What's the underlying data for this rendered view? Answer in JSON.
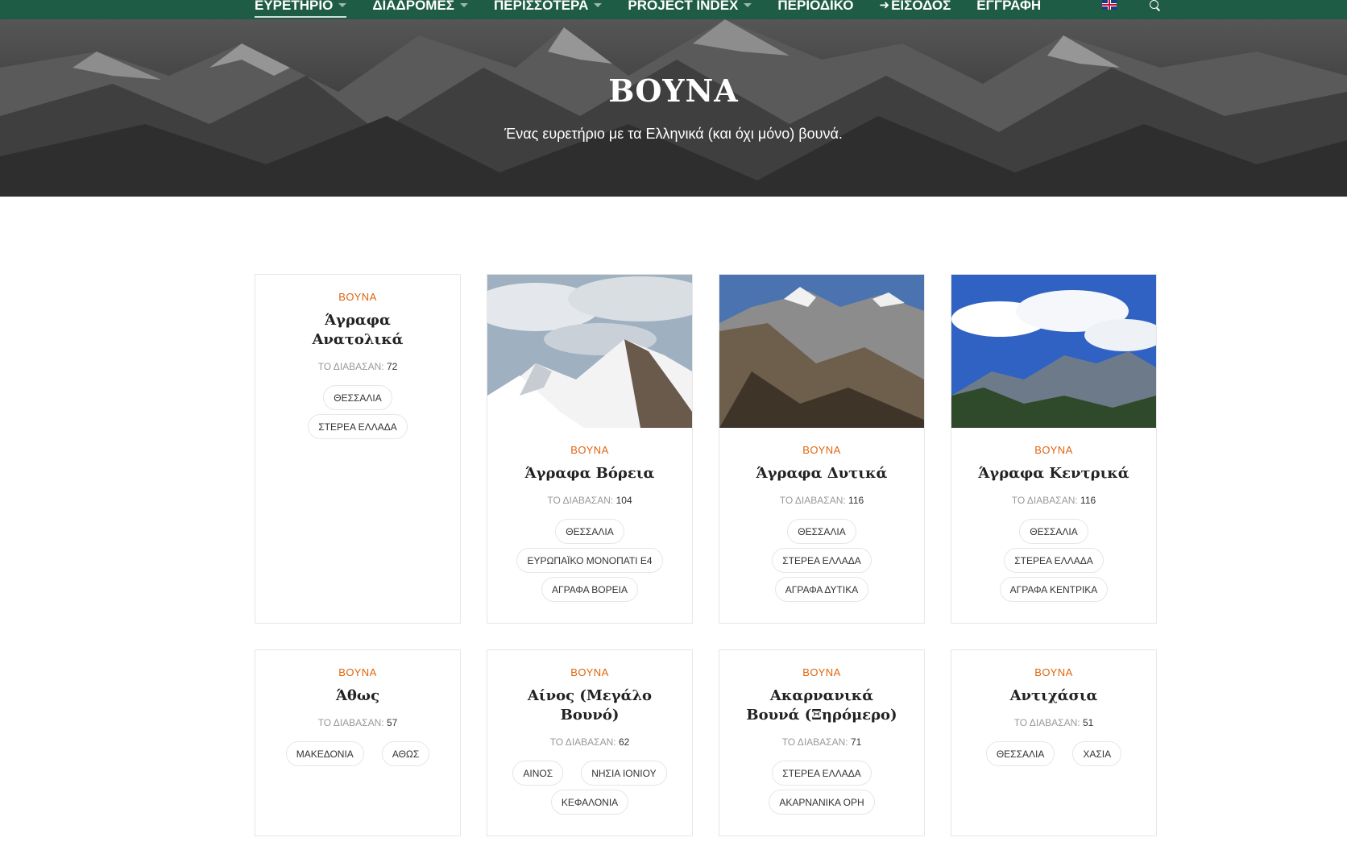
{
  "nav": {
    "items": [
      {
        "label": "ΕΥΡΕΤΗΡΙΟ",
        "caret": true,
        "active": true
      },
      {
        "label": "ΔΙΑΔΡΟΜΕΣ",
        "caret": true
      },
      {
        "label": "ΠΕΡΙΣΣΟΤΕΡΑ",
        "caret": true
      },
      {
        "label": "PROJECT INDEX",
        "caret": true
      },
      {
        "label": "ΠΕΡΙΟΔΙΚΟ",
        "caret": false
      },
      {
        "label": "ΕΙΣΟΔΟΣ",
        "caret": false,
        "icon": "login-icon"
      },
      {
        "label": "ΕΓΓΡΑΦΗ",
        "caret": false
      }
    ],
    "language_icon": "uk-flag-icon",
    "search_icon": "search-icon"
  },
  "hero": {
    "title": "ΒΟΥΝΑ",
    "subtitle": "Ένας ευρετήριο με τα Ελληνικά (και όχι μόνο) βουνά."
  },
  "cards": [
    {
      "category": "ΒΟΥΝΑ",
      "title": "Άγραφα Ανατολικά",
      "reads_label": "ΤΟ ΔΙΑΒΑΣΑΝ:",
      "reads": "72",
      "tags": [
        [
          "ΘΕΣΣΑΛΙΑ"
        ],
        [
          "ΣΤΕΡΕΑ ΕΛΛΑΔΑ"
        ]
      ],
      "image": null
    },
    {
      "category": "ΒΟΥΝΑ",
      "title": "Άγραφα Βόρεια",
      "reads_label": "ΤΟ ΔΙΑΒΑΣΑΝ:",
      "reads": "104",
      "tags": [
        [
          "ΘΕΣΣΑΛΙΑ"
        ],
        [
          "ΕΥΡΩΠΑΪΚΟ ΜΟΝΟΠΑΤΙ Ε4"
        ],
        [
          "ΑΓΡΑΦΑ ΒΟΡΕΙΑ"
        ]
      ],
      "image": "snowy-mountain"
    },
    {
      "category": "ΒΟΥΝΑ",
      "title": "Άγραφα Δυτικά",
      "reads_label": "ΤΟ ΔΙΑΒΑΣΑΝ:",
      "reads": "116",
      "tags": [
        [
          "ΘΕΣΣΑΛΙΑ"
        ],
        [
          "ΣΤΕΡΕΑ ΕΛΛΑΔΑ"
        ],
        [
          "ΑΓΡΑΦΑ ΔΥΤΙΚΑ"
        ]
      ],
      "image": "rocky-ridges"
    },
    {
      "category": "ΒΟΥΝΑ",
      "title": "Άγραφα Κεντρικά",
      "reads_label": "ΤΟ ΔΙΑΒΑΣΑΝ:",
      "reads": "116",
      "tags": [
        [
          "ΘΕΣΣΑΛΙΑ"
        ],
        [
          "ΣΤΕΡΕΑ ΕΛΛΑΔΑ"
        ],
        [
          "ΑΓΡΑΦΑ ΚΕΝΤΡΙΚΑ"
        ]
      ],
      "image": "blue-sky-peaks"
    },
    {
      "category": "ΒΟΥΝΑ",
      "title": "Άθως",
      "reads_label": "ΤΟ ΔΙΑΒΑΣΑΝ:",
      "reads": "57",
      "tags": [
        [
          "ΜΑΚΕΔΟΝΙΑ",
          "ΑΘΩΣ"
        ]
      ],
      "image": null
    },
    {
      "category": "ΒΟΥΝΑ",
      "title": "Αίνος (Μεγάλο Βουνό)",
      "reads_label": "ΤΟ ΔΙΑΒΑΣΑΝ:",
      "reads": "62",
      "tags": [
        [
          "ΑΙΝΟΣ",
          "ΝΗΣΙΑ ΙΟΝΙΟΥ"
        ],
        [
          "ΚΕΦΑΛΟΝΙΑ"
        ]
      ],
      "image": null
    },
    {
      "category": "ΒΟΥΝΑ",
      "title": "Ακαρνανικά Βουνά (Ξηρόμερο)",
      "reads_label": "ΤΟ ΔΙΑΒΑΣΑΝ:",
      "reads": "71",
      "tags": [
        [
          "ΣΤΕΡΕΑ ΕΛΛΑΔΑ"
        ],
        [
          "ΑΚΑΡΝΑΝΙΚΑ ΟΡΗ"
        ]
      ],
      "image": null
    },
    {
      "category": "ΒΟΥΝΑ",
      "title": "Αντιχάσια",
      "reads_label": "ΤΟ ΔΙΑΒΑΣΑΝ:",
      "reads": "51",
      "tags": [
        [
          "ΘΕΣΣΑΛΙΑ",
          "ΧΑΣΙΑ"
        ]
      ],
      "image": null
    }
  ],
  "colors": {
    "nav_bg": "#1f5c45",
    "accent": "#e0630a",
    "border": "#e6e6e6"
  }
}
